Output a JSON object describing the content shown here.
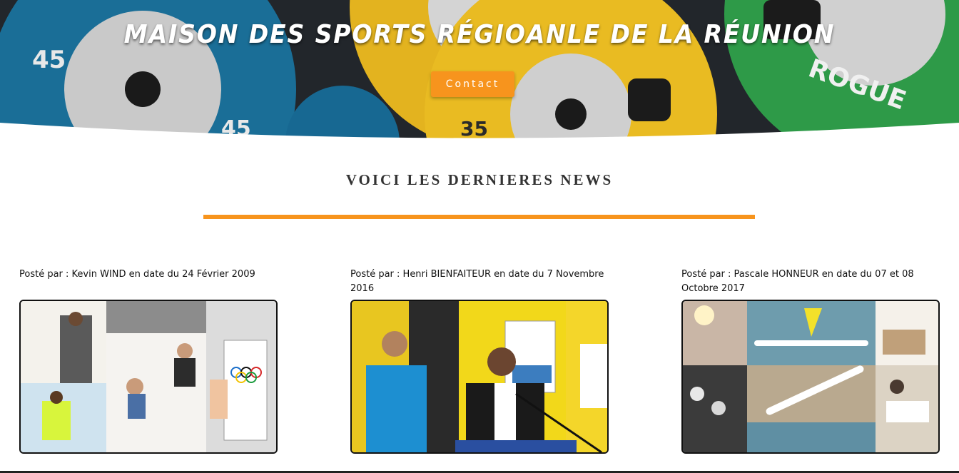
{
  "hero": {
    "title": "MAISON DES SPORTS RÉGIOANLE DE LA RÉUNION",
    "contact_label": "Contact",
    "accent_color": "#f7941d"
  },
  "news": {
    "heading": "VOICI LES DERNIERES NEWS",
    "posts": [
      {
        "meta": "Posté par : Kevin WIND en date du 24 Février 2009",
        "image": "olympic-day-collage-photo"
      },
      {
        "meta": "Posté par : Henri BIENFAITEUR en date du 7 Novembre 2016",
        "image": "inauguration-speech-photo"
      },
      {
        "meta": "Posté par : Pascale HONNEUR en date du 07 et 08 Octobre 2017",
        "image": "kayak-event-collage-photo"
      }
    ]
  }
}
